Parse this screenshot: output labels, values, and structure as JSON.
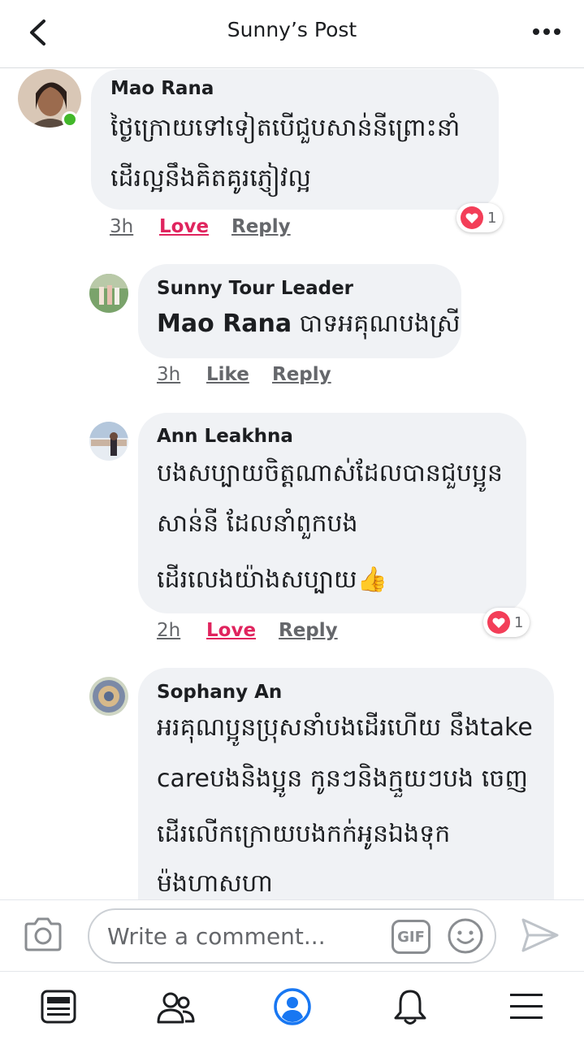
{
  "header": {
    "title": "Sunny’s Post",
    "back_icon": "chevron-left-icon",
    "more_icon": "more-horizontal-icon"
  },
  "comments": [
    {
      "author": "Mao Rana",
      "lines": [
        "ថ្ងៃក្រោយទៅទៀតបើជួបសាន់នីព្រោះនាំ",
        "ដើរល្អនឹងគិតគូរភ្ញៀវល្អ"
      ],
      "time": "3h",
      "reaction_label": "Love",
      "reply_label": "Reply",
      "reaction_count": "1",
      "online": true
    },
    {
      "author": "Sunny Tour Leader",
      "mention": "Mao Rana",
      "lines": [
        " បាទអគុណបងស្រី"
      ],
      "time": "3h",
      "reaction_label": "Like",
      "reply_label": "Reply"
    },
    {
      "author": "Ann Leakhna",
      "lines": [
        "បងសប្បាយចិត្តណាស់ដែលបានជួបប្អូន",
        "សាន់នី ដែលនាំពួកបង",
        "ដើរលេងយ៉ាងសប្បាយ👍"
      ],
      "time": "2h",
      "reaction_label": "Love",
      "reply_label": "Reply",
      "reaction_count": "1"
    },
    {
      "author": "Sophany An",
      "lines": [
        "អរគុណប្អូនប្រុសនាំបងដើរហើយ នឹងtake",
        "careបងនិងប្អូន កូនៗនិងក្មួយៗបង  ចេញ",
        "ដើរលើកក្រោយបងកក់អូនឯងទុក",
        "ម៉ងហាសហា"
      ]
    }
  ],
  "composer": {
    "placeholder": "Write a comment...",
    "gif_label": "GIF"
  },
  "bottom_nav": {
    "items": [
      "news-feed-icon",
      "groups-icon",
      "profile-icon",
      "notifications-bell-icon",
      "menu-icon"
    ]
  },
  "colors": {
    "love": "#e0245e",
    "bubble": "#f0f2f5",
    "online": "#42b72a",
    "active_nav": "#1877f2"
  }
}
